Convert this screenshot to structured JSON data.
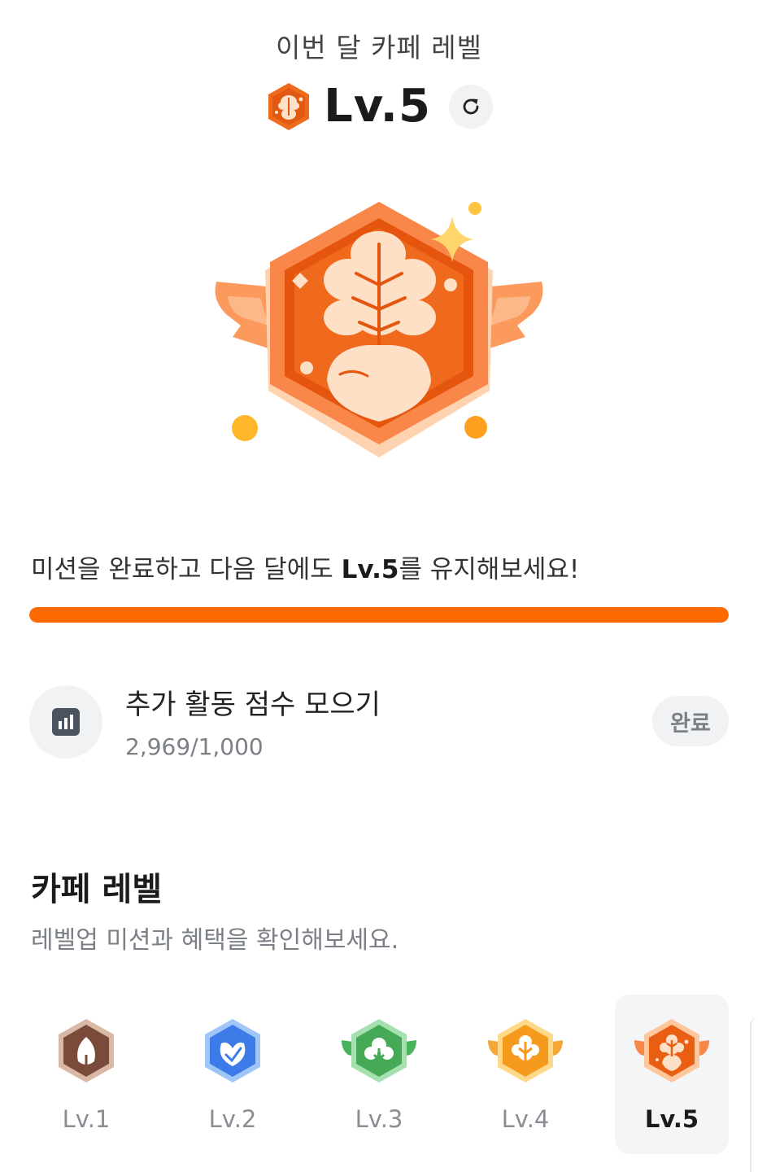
{
  "header": {
    "month_title": "이번 달 카페 레벨",
    "current_level": "Lv.5",
    "refresh_icon": "refresh-icon"
  },
  "mission": {
    "text_before": "미션을 완료하고 다음 달에도 ",
    "text_level": "Lv.5",
    "text_after": "를 유지해보세요!",
    "progress_fraction": 1.0,
    "progress_color": "#ff6a00"
  },
  "score": {
    "icon": "bar-chart-icon",
    "title": "추가 활동 점수 모으기",
    "value": "2,969/1,000",
    "status": "완료"
  },
  "cafe_levels": {
    "title": "카페 레벨",
    "subtitle": "레벨업 미션과 혜택을 확인해보세요.",
    "items": [
      {
        "label": "Lv.1",
        "color": "#8a5a48",
        "icon": "seed-badge-icon"
      },
      {
        "label": "Lv.2",
        "color": "#3d7be8",
        "icon": "sprout-badge-icon"
      },
      {
        "label": "Lv.3",
        "color": "#4cb35d",
        "icon": "tree-badge-icon"
      },
      {
        "label": "Lv.4",
        "color": "#f59a1c",
        "icon": "leaf-badge-icon"
      },
      {
        "label": "Lv.5",
        "color": "#f06a1e",
        "icon": "radish-badge-icon",
        "selected": true
      }
    ]
  }
}
